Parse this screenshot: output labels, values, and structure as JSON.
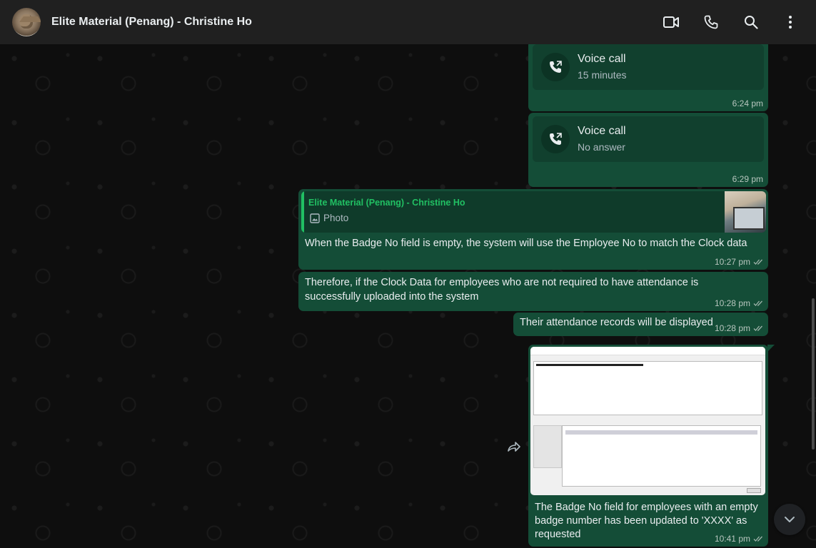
{
  "header": {
    "title": "Elite Material (Penang) - Christine Ho",
    "icons": [
      "video-call-icon",
      "voice-call-icon",
      "search-icon",
      "menu-icon"
    ]
  },
  "messages": {
    "call1": {
      "title": "Voice call",
      "subtitle": "15 minutes",
      "time": "6:24 pm"
    },
    "call2": {
      "title": "Voice call",
      "subtitle": "No answer",
      "time": "6:29 pm"
    },
    "reply": {
      "quote_author": "Elite Material (Penang) - Christine Ho",
      "quote_type": "Photo",
      "text": "When the Badge No field is empty, the system will use the Employee No to match the Clock data",
      "time": "10:27 pm"
    },
    "msg2": {
      "text": "Therefore, if the Clock Data for employees who are not required to have attendance is successfully uploaded into the system",
      "time": "10:28 pm"
    },
    "msg3": {
      "text": "Their attendance records will be displayed",
      "time": "10:28 pm"
    },
    "image_msg": {
      "caption": "The Badge No field for employees with an empty badge number has been updated to 'XXXX' as requested",
      "time": "10:41 pm"
    }
  },
  "colors": {
    "header_bg": "#202020",
    "outgoing_bubble": "#144d37",
    "accent_green": "#21c063",
    "chat_bg": "#0e0e0e"
  }
}
